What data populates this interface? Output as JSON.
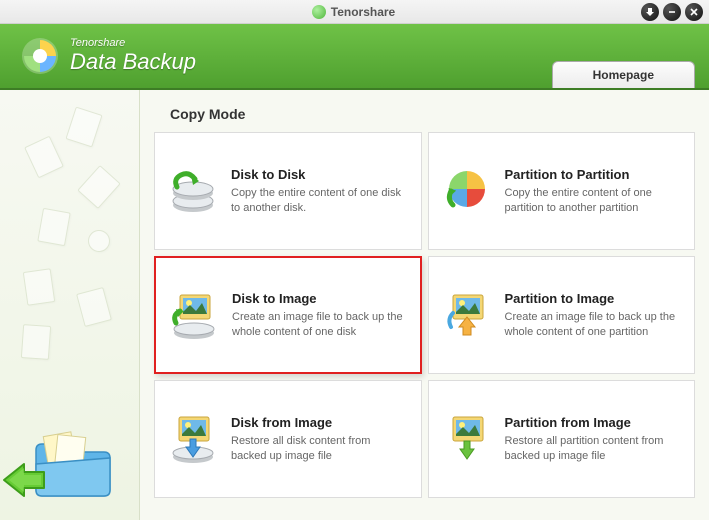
{
  "titlebar": {
    "brand": "Tenorshare"
  },
  "header": {
    "subtitle": "Tenorshare",
    "title": "Data Backup",
    "tab": "Homepage"
  },
  "section_title": "Copy Mode",
  "cards": [
    {
      "title": "Disk to Disk",
      "desc": "Copy the entire content of one disk to another disk."
    },
    {
      "title": "Partition to Partition",
      "desc": "Copy the entire content of one partition to another partition"
    },
    {
      "title": "Disk to Image",
      "desc": "Create an image file to back up the whole content of one disk"
    },
    {
      "title": "Partition to Image",
      "desc": "Create an image file to back up the whole content of one partition"
    },
    {
      "title": "Disk from Image",
      "desc": "Restore all disk content from backed up image file"
    },
    {
      "title": "Partition from Image",
      "desc": "Restore all partition content from backed up image file"
    }
  ]
}
